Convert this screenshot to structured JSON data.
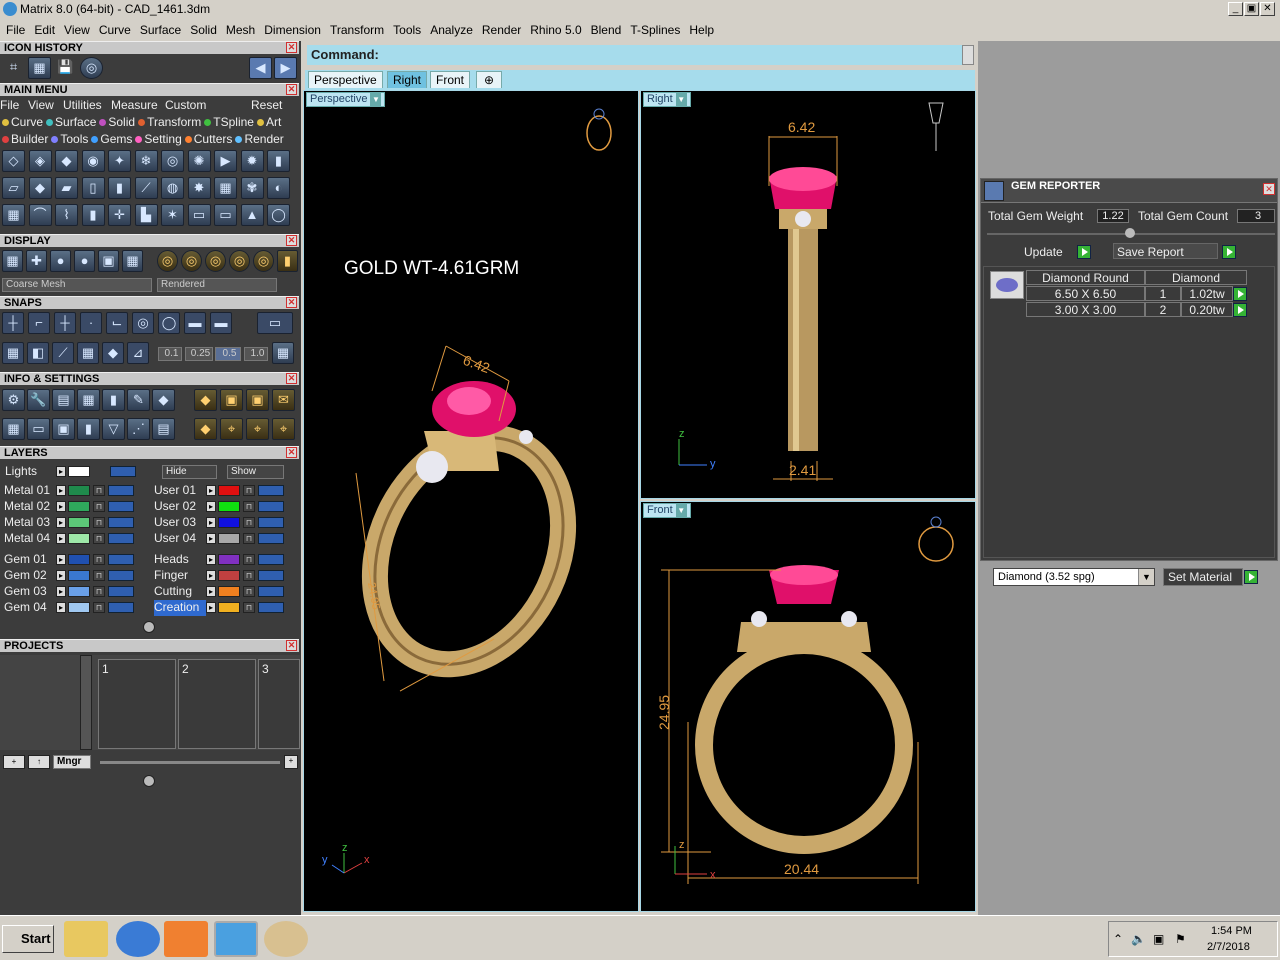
{
  "window": {
    "title": "Matrix 8.0 (64-bit) - CAD_1461.3dm",
    "btn_min": "_",
    "btn_max": "▣",
    "btn_close": "✕"
  },
  "menubar": [
    "File",
    "Edit",
    "View",
    "Curve",
    "Surface",
    "Solid",
    "Mesh",
    "Dimension",
    "Transform",
    "Tools",
    "Analyze",
    "Render",
    "Rhino 5.0",
    "Blend",
    "T-Splines",
    "Help"
  ],
  "left": {
    "icon_history": "ICON HISTORY",
    "main_menu": "MAIN MENU",
    "menu_row": [
      "File",
      "View",
      "Utilities",
      "Measure",
      "Custom"
    ],
    "reset": "Reset",
    "cat_row1": [
      {
        "label": "Curve",
        "color": "#e0c040"
      },
      {
        "label": "Surface",
        "color": "#40c0c0"
      },
      {
        "label": "Solid",
        "color": "#c050c0"
      },
      {
        "label": "Transform",
        "color": "#e06030"
      },
      {
        "label": "TSpline",
        "color": "#40c040"
      },
      {
        "label": "Art",
        "color": "#e0c040"
      }
    ],
    "cat_row2": [
      {
        "label": "Builder",
        "color": "#e04040"
      },
      {
        "label": "Tools",
        "color": "#8080ff"
      },
      {
        "label": "Gems",
        "color": "#40a0ff"
      },
      {
        "label": "Setting",
        "color": "#ff60c0"
      },
      {
        "label": "Cutters",
        "color": "#ff8030"
      },
      {
        "label": "Render",
        "color": "#60c0ff"
      }
    ],
    "display": "DISPLAY",
    "mesh_combo": "Coarse Mesh",
    "render_combo": "Rendered",
    "snaps": "SNAPS",
    "snap_values": [
      "0.1",
      "0.25",
      "0.5",
      "1.0"
    ],
    "info_settings": "INFO & SETTINGS",
    "layers": "LAYERS",
    "lights": "Lights",
    "hide": "Hide",
    "show": "Show",
    "metal_layers": [
      {
        "name": "Metal 01",
        "color": "#1f8a4c"
      },
      {
        "name": "Metal 02",
        "color": "#2fa85c"
      },
      {
        "name": "Metal 03",
        "color": "#5cc878"
      },
      {
        "name": "Metal 04",
        "color": "#9ee8a8"
      }
    ],
    "user_layers": [
      {
        "name": "User 01",
        "color": "#e01010"
      },
      {
        "name": "User 02",
        "color": "#10e010"
      },
      {
        "name": "User 03",
        "color": "#1010e0"
      },
      {
        "name": "User 04",
        "color": "#a8a8a8"
      }
    ],
    "gem_layers": [
      {
        "name": "Gem 01",
        "color": "#2050b0"
      },
      {
        "name": "Gem 02",
        "color": "#3a78d0"
      },
      {
        "name": "Gem 03",
        "color": "#6aa0e8"
      },
      {
        "name": "Gem 04",
        "color": "#a0c8f0"
      }
    ],
    "other_layers": [
      {
        "name": "Heads",
        "color": "#8030c0"
      },
      {
        "name": "Finger",
        "color": "#c04040"
      },
      {
        "name": "Cutting",
        "color": "#f08020"
      },
      {
        "name": "Creation",
        "color": "#f0b020"
      }
    ],
    "projects": "PROJECTS",
    "project_slots": [
      "1",
      "2",
      "3"
    ],
    "mngr": "Mngr"
  },
  "command": {
    "label": "Command:",
    "tabs": [
      "Perspective",
      "Right",
      "Front",
      "⊕"
    ],
    "active_tab": "Right"
  },
  "viewports": {
    "perspective": {
      "label": "Perspective",
      "annotation": "GOLD WT-4.61GRM",
      "dim_top": "6.42",
      "dim_side": "24.95"
    },
    "right": {
      "label": "Right",
      "dim_top": "6.42",
      "dim_bottom": "2.41"
    },
    "front": {
      "label": "Front",
      "dim_side": "24.95",
      "dim_bottom": "20.44"
    }
  },
  "gem_reporter": {
    "title": "GEM REPORTER",
    "total_weight_label": "Total Gem Weight",
    "total_weight": "1.22",
    "total_count_label": "Total Gem Count",
    "total_count": "3",
    "update": "Update",
    "save_report": "Save Report",
    "header": [
      "Diamond Round",
      "Diamond"
    ],
    "rows": [
      {
        "size": "6.50 X 6.50",
        "qty": "1",
        "wt": "1.02tw"
      },
      {
        "size": "3.00 X 3.00",
        "qty": "2",
        "wt": "0.20tw"
      }
    ],
    "material_combo": "Diamond    (3.52 spg)",
    "set_material": "Set Material"
  },
  "taskbar": {
    "start": "Start",
    "time": "1:54 PM",
    "date": "2/7/2018"
  },
  "colors": {
    "cad_dim": "#e09a40",
    "gold": "#c9a86a",
    "ruby": "#e0106a",
    "viewport_bg": "#000000",
    "panel_bg": "#3c3c3c",
    "cmd_blue": "#a6dcec"
  }
}
